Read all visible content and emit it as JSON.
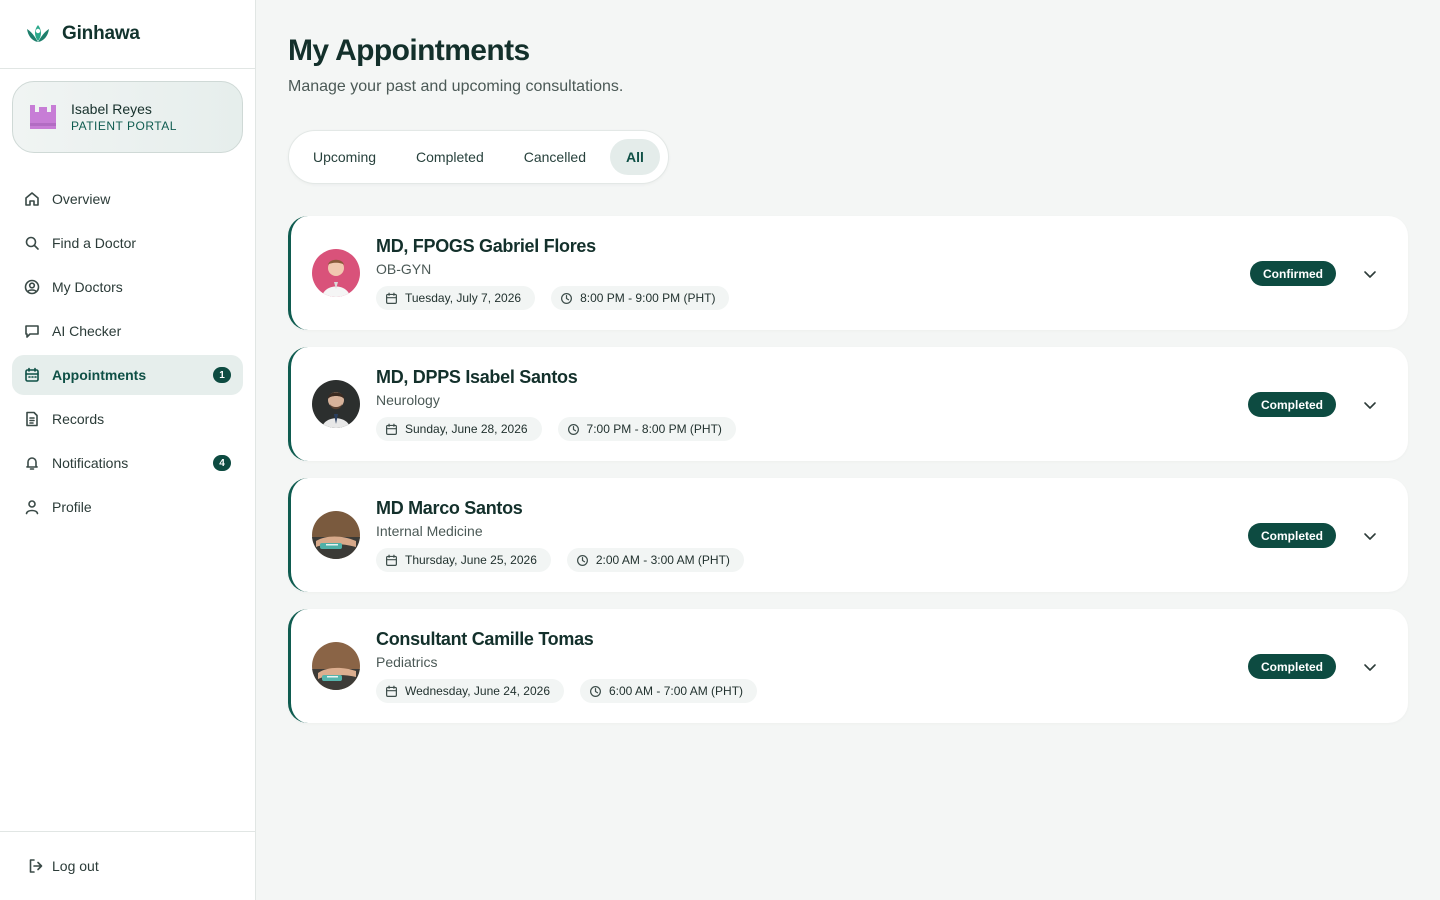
{
  "brand": {
    "name": "Ginhawa",
    "logo_icon": "lotus-logo-icon",
    "accent": "#0f5c50"
  },
  "user": {
    "name": "Isabel Reyes",
    "role": "PATIENT PORTAL",
    "avatar_icon": "castle-avatar-icon",
    "avatar_color": "#c77dd6"
  },
  "nav": {
    "items": [
      {
        "key": "overview",
        "label": "Overview",
        "icon": "home-icon"
      },
      {
        "key": "find-doctor",
        "label": "Find a Doctor",
        "icon": "search-icon"
      },
      {
        "key": "my-doctors",
        "label": "My Doctors",
        "icon": "user-circle-icon"
      },
      {
        "key": "ai-checker",
        "label": "AI Checker",
        "icon": "chat-icon"
      },
      {
        "key": "appointments",
        "label": "Appointments",
        "icon": "calendar-icon",
        "badge": "1",
        "active": true
      },
      {
        "key": "records",
        "label": "Records",
        "icon": "document-icon"
      },
      {
        "key": "notifications",
        "label": "Notifications",
        "icon": "bell-icon",
        "badge": "4"
      },
      {
        "key": "profile",
        "label": "Profile",
        "icon": "user-icon"
      }
    ],
    "logout": "Log out"
  },
  "header": {
    "title": "My Appointments",
    "subtitle": "Manage your past and upcoming consultations."
  },
  "tabs": [
    {
      "label": "Upcoming"
    },
    {
      "label": "Completed"
    },
    {
      "label": "Cancelled"
    },
    {
      "label": "All",
      "active": true
    }
  ],
  "appointments": [
    {
      "doctor": "MD, FPOGS Gabriel Flores",
      "specialty": "OB-GYN",
      "date": "Tuesday, July 7, 2026",
      "time": "8:00 PM - 9:00 PM (PHT)",
      "status": "Confirmed"
    },
    {
      "doctor": "MD, DPPS Isabel Santos",
      "specialty": "Neurology",
      "date": "Sunday, June 28, 2026",
      "time": "7:00 PM - 8:00 PM (PHT)",
      "status": "Completed"
    },
    {
      "doctor": "MD Marco Santos",
      "specialty": "Internal Medicine",
      "date": "Thursday, June 25, 2026",
      "time": "2:00 AM - 3:00 AM (PHT)",
      "status": "Completed"
    },
    {
      "doctor": "Consultant Camille Tomas",
      "specialty": "Pediatrics",
      "date": "Wednesday, June 24, 2026",
      "time": "6:00 AM - 7:00 AM (PHT)",
      "status": "Completed"
    }
  ]
}
